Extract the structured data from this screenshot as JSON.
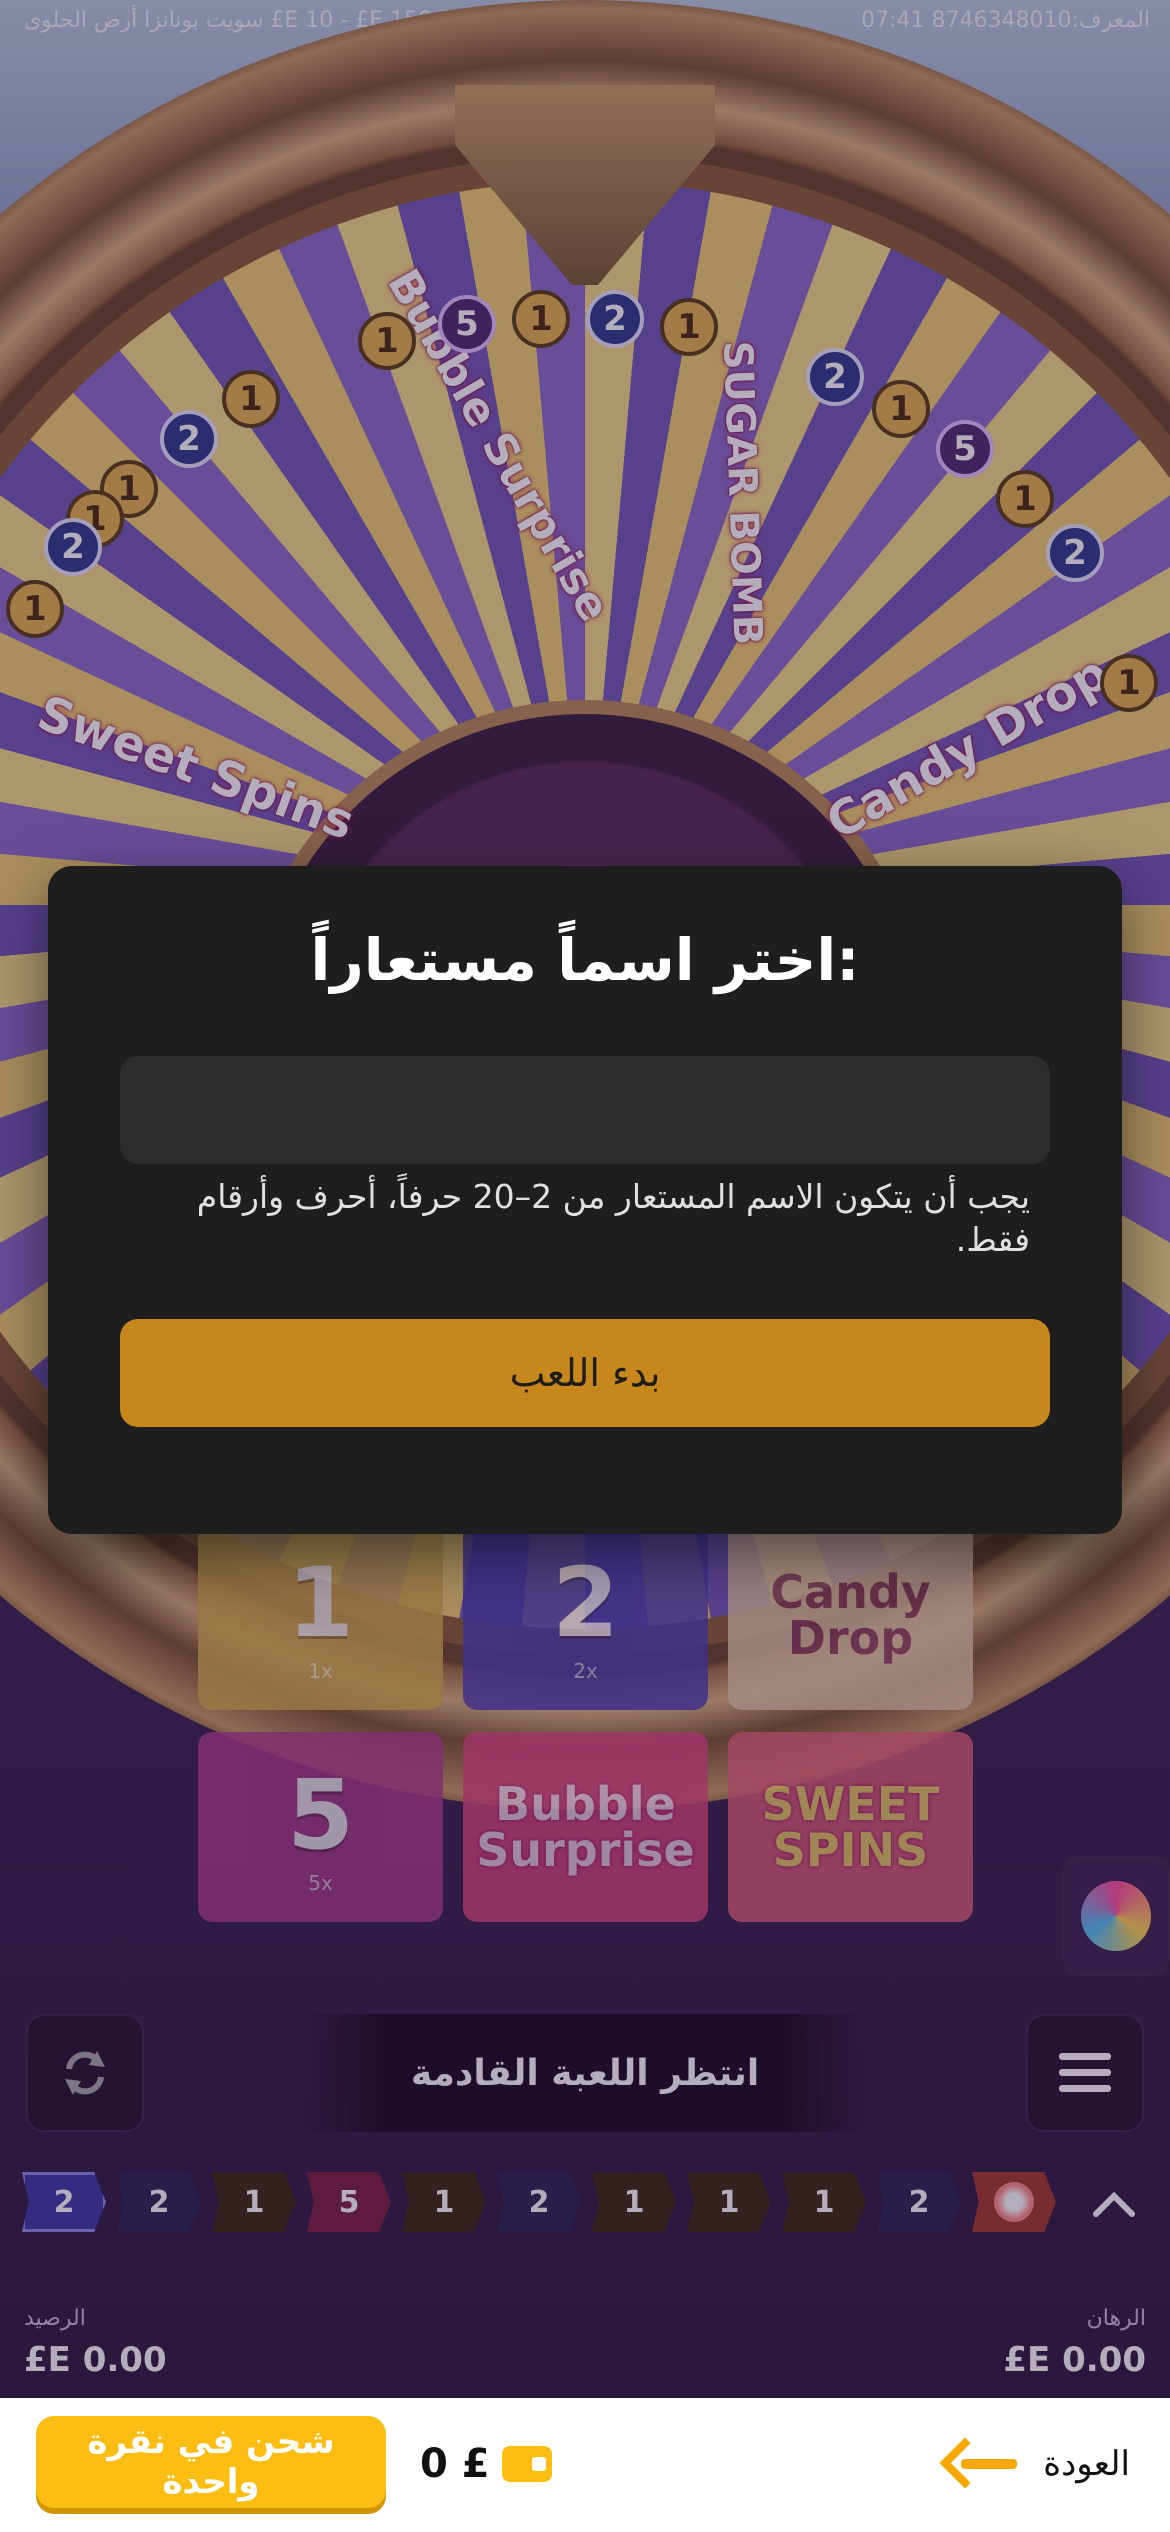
{
  "status_bar": {
    "left_text": "سويت بونانزا أرض الحلوى  £E 10 - £E 150,000",
    "right_text": "المعرف:8746348010  07:41"
  },
  "wheel": {
    "segments": [
      "Bubble Surprise",
      "SUGAR BOMB",
      "Sweet Spins",
      "Candy Drop"
    ],
    "chips_top": [
      "1",
      "5",
      "1",
      "2",
      "1"
    ],
    "chips_left": [
      "1",
      "2",
      "1",
      "1",
      "2",
      "1"
    ],
    "chips_right": [
      "2",
      "1",
      "5",
      "1",
      "2",
      "1"
    ]
  },
  "modal": {
    "title": "اختر اسماً مستعاراً:",
    "input_value": "",
    "hint": "يجب أن يتكون الاسم المستعار من 2–20 حرفاً، أحرف وأرقام فقط.",
    "start_label": "بدء اللعب"
  },
  "tiles": [
    {
      "label": "1",
      "multiplier": "1x",
      "color": "#d8b04a"
    },
    {
      "label": "2",
      "multiplier": "2x",
      "color": "#4b3fb0"
    },
    {
      "label": "Candy Drop",
      "multiplier": "",
      "color": "#e9c9a8"
    },
    {
      "label": "5",
      "multiplier": "5x",
      "color": "#b03d8e"
    },
    {
      "label": "Bubble Surprise",
      "multiplier": "",
      "color": "#e0487c"
    },
    {
      "label": "SWEET SPINS",
      "multiplier": "",
      "color": "#e8617a"
    }
  ],
  "controls": {
    "wait_text": "انتظر اللعبة القادمة"
  },
  "history": [
    "2",
    "2",
    "1",
    "5",
    "1",
    "2",
    "1",
    "1",
    "1",
    "2"
  ],
  "footer": {
    "bet_label": "الرهان",
    "bet_value": "£E 0.00",
    "balance_label": "الرصيد",
    "balance_value": "£E 0.00"
  },
  "appbar": {
    "back_label": "العودة",
    "wallet_amount": "0 £",
    "topup_label": "شحن في نقرة واحدة"
  }
}
